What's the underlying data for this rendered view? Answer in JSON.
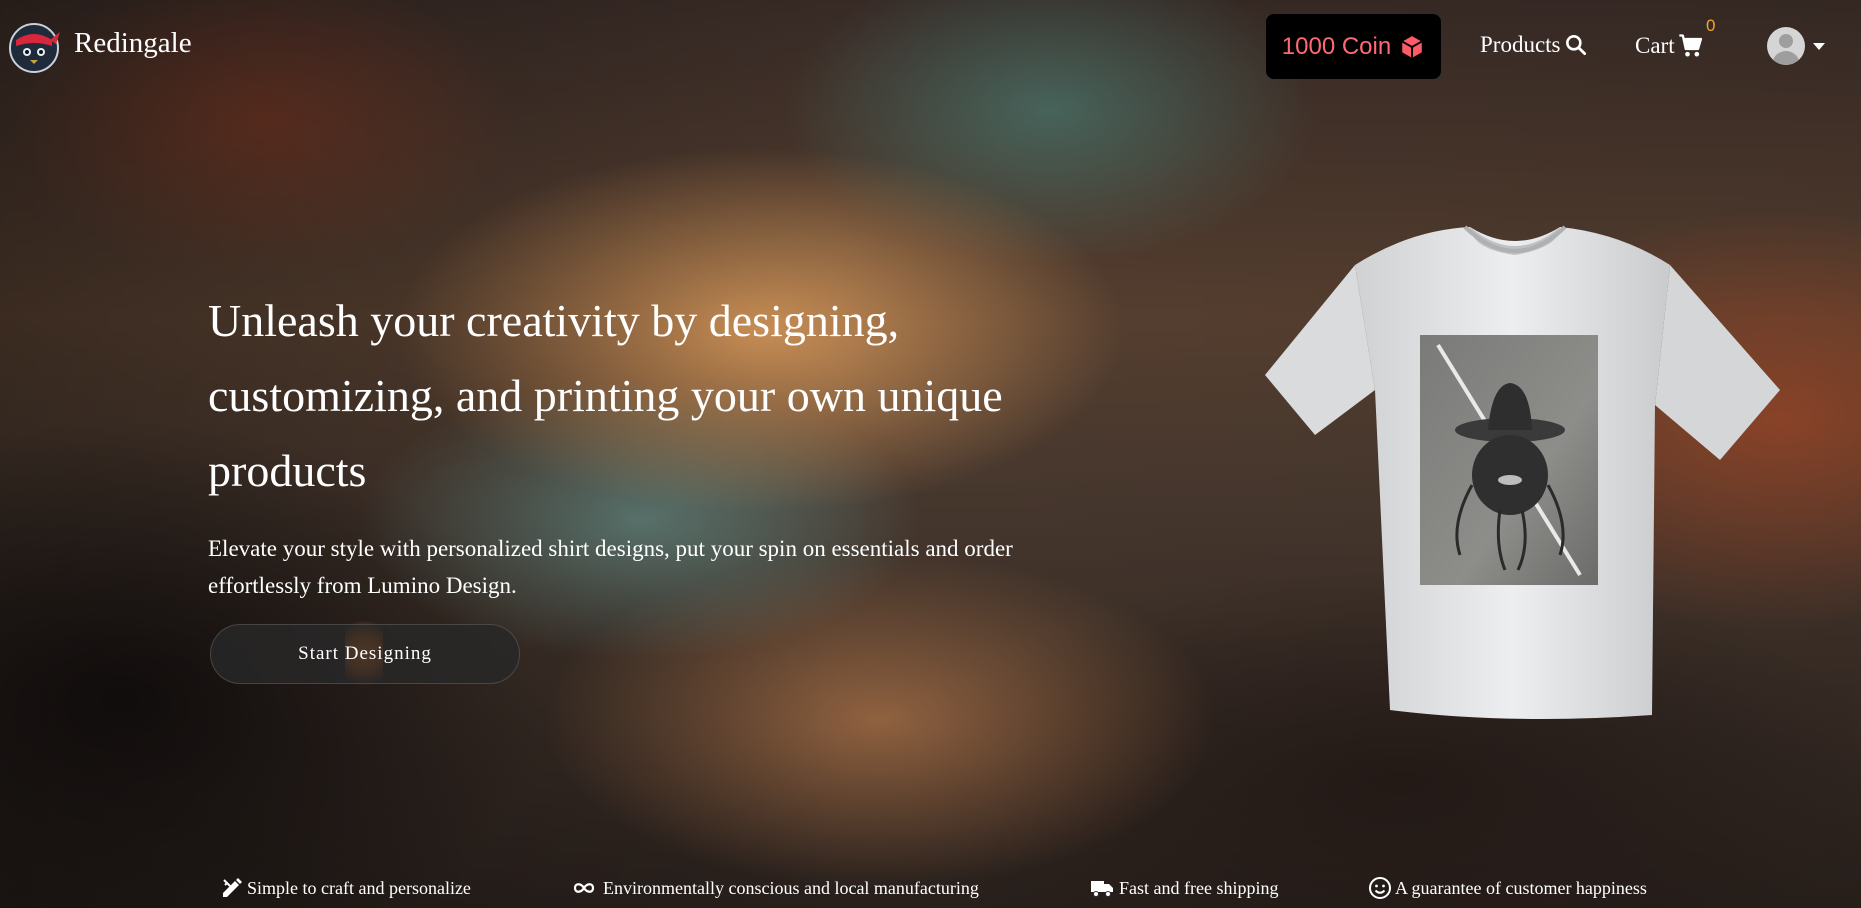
{
  "brand": {
    "name": "Redingale"
  },
  "nav": {
    "coin_label": "1000 Coin",
    "products_label": "Products",
    "cart_label": "Cart",
    "cart_count": "0"
  },
  "hero": {
    "headline": "Unleash your creativity by designing, customizing, and printing your own unique products",
    "subtext": "Elevate your style with personalized shirt designs, put your spin on essentials and order effortlessly from Lumino Design.",
    "cta_label": "Start Designing"
  },
  "features": [
    {
      "icon": "pencil-ruler-icon",
      "label": "Simple to craft and personalize"
    },
    {
      "icon": "infinity-icon",
      "label": "Environmentally conscious and local manufacturing"
    },
    {
      "icon": "truck-icon",
      "label": "Fast and free shipping"
    },
    {
      "icon": "smiley-icon",
      "label": "A guarantee of customer happiness"
    }
  ],
  "colors": {
    "coin_text": "#ff6a72",
    "coin_bg": "#000000",
    "cart_badge": "#f5a623",
    "cta_bg": "#2a2a2a"
  }
}
